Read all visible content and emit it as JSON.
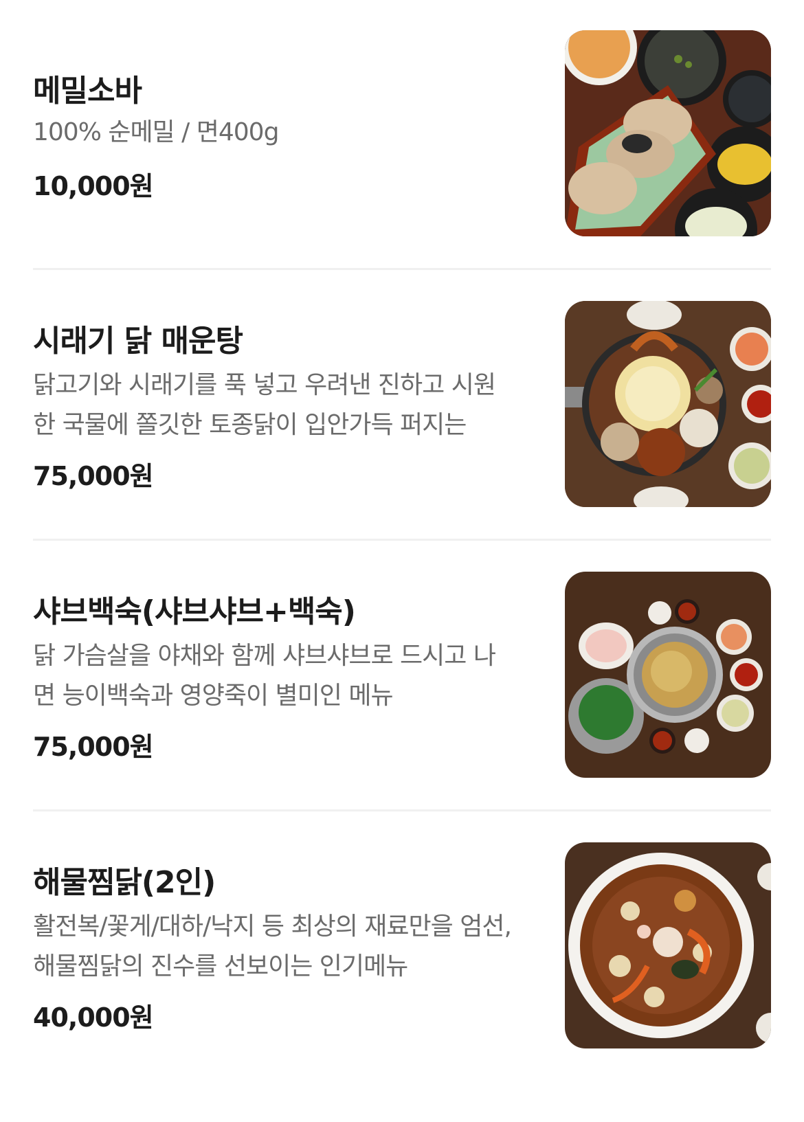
{
  "menu": {
    "items": [
      {
        "name": "메밀소바",
        "description": "100% 순메밀 / 면400g",
        "price": "10,000원",
        "image_icon": "soba-noodle-photo"
      },
      {
        "name": "시래기 닭 매운탕",
        "description": "닭고기와 시래기를 푹 넣고 우려낸 진하고 시원한 국물에 쫄깃한 토종닭이 입안가득 퍼지는",
        "price": "75,000원",
        "image_icon": "chicken-stew-photo"
      },
      {
        "name": "샤브백숙(샤브샤브+백숙)",
        "description": "닭 가슴살을 야채와 함께 샤브샤브로 드시고 나면 능이백숙과 영양죽이 별미인 메뉴",
        "price": "75,000원",
        "image_icon": "shabu-shabu-photo"
      },
      {
        "name": "해물찜닭(2인)",
        "description": "활전복/꽃게/대하/낙지 등 최상의 재료만을 엄선, 해물찜닭의 진수를 선보이는 인기메뉴",
        "price": "40,000원",
        "image_icon": "seafood-braised-chicken-photo"
      }
    ]
  },
  "colors": {
    "text_primary": "#1c1c1c",
    "text_secondary": "#6b6b6b",
    "divider": "#f0f0f0"
  }
}
